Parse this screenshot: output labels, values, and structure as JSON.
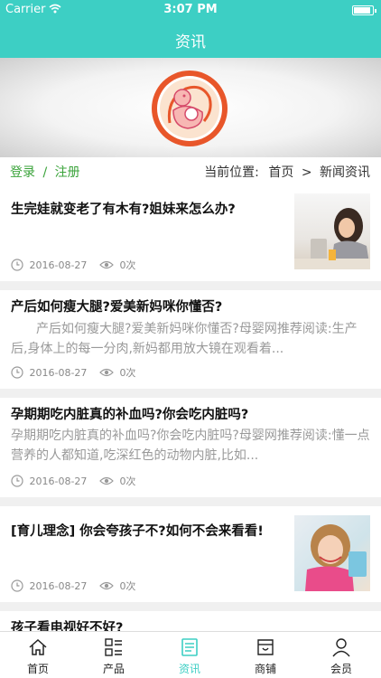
{
  "status_bar": {
    "carrier": "Carrier",
    "time": "3:07 PM"
  },
  "nav": {
    "title": "资讯"
  },
  "auth": {
    "login": "登录",
    "separator": "/",
    "register": "注册"
  },
  "breadcrumb": {
    "prefix": "当前位置:",
    "home": "首页",
    "separator": ">",
    "current": "新闻资讯"
  },
  "articles": [
    {
      "title": "生完娃就变老了有木有?姐妹来怎么办?",
      "excerpt": "",
      "date": "2016-08-27",
      "views": "0次"
    },
    {
      "title": "产后如何瘦大腿?爱美新妈咪你懂否?",
      "excerpt": "产后如何瘦大腿?爱美新妈咪你懂否?母婴网推荐阅读:生产后,身体上的每一分肉,新妈都用放大镜在观看着...",
      "date": "2016-08-27",
      "views": "0次"
    },
    {
      "title": "孕期期吃内脏真的补血吗?你会吃内脏吗?",
      "excerpt": "孕期期吃内脏真的补血吗?你会吃内脏吗?母婴网推荐阅读:懂一点营养的人都知道,吃深红色的动物内脏,比如...",
      "date": "2016-08-27",
      "views": "0次"
    },
    {
      "title": "[育儿理念] 你会夸孩子不?如何不会来看看!",
      "excerpt": "",
      "date": "2016-08-27",
      "views": "0次"
    },
    {
      "title": "孩子看电视好不好?",
      "excerpt": "",
      "date": "",
      "views": ""
    }
  ],
  "tabs": [
    {
      "label": "首页",
      "icon": "home-icon"
    },
    {
      "label": "产品",
      "icon": "grid-list-icon"
    },
    {
      "label": "资讯",
      "icon": "news-icon"
    },
    {
      "label": "商铺",
      "icon": "shop-icon"
    },
    {
      "label": "会员",
      "icon": "user-icon"
    }
  ],
  "colors": {
    "primary": "#3dcfc4",
    "auth_green": "#3aa33a",
    "logo_orange": "#e8562a"
  }
}
